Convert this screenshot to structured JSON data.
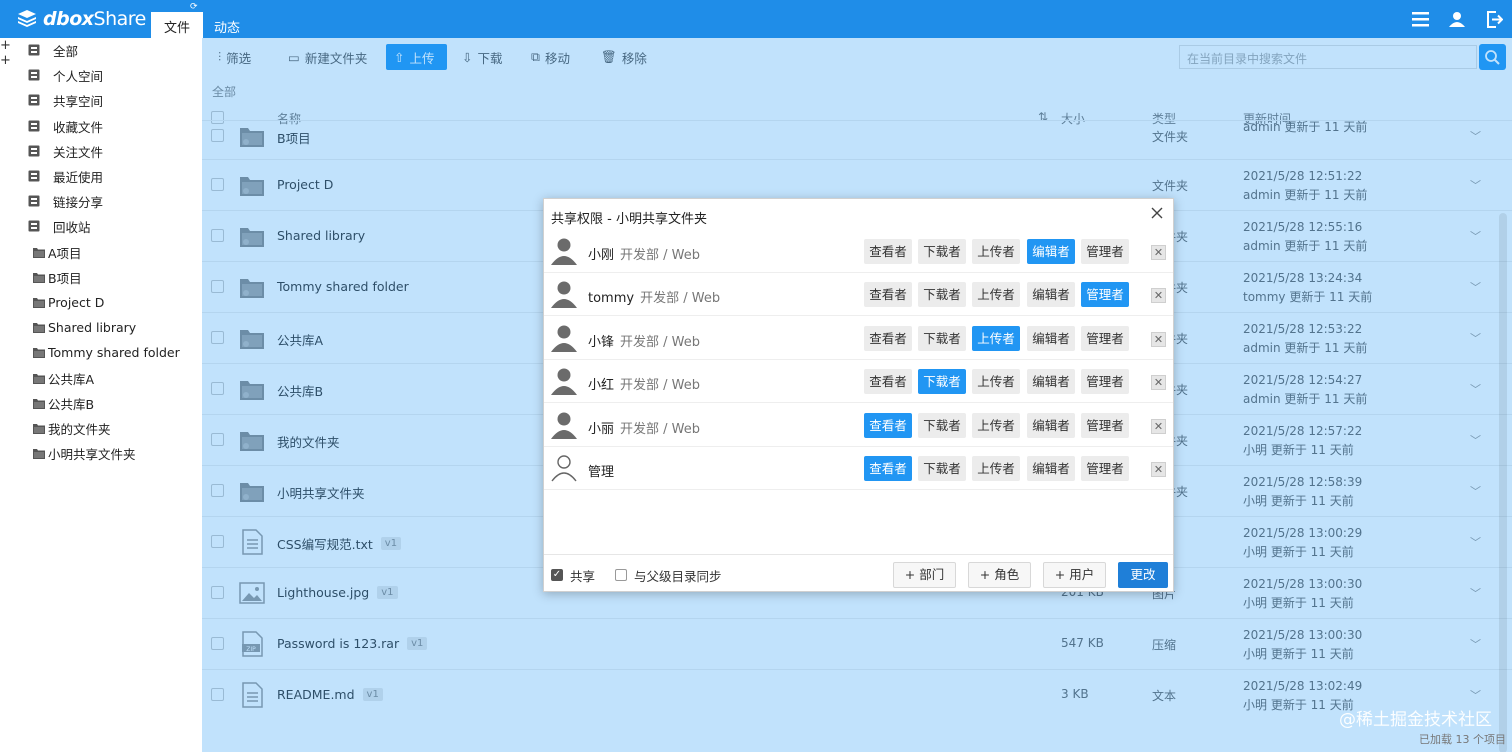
{
  "app": {
    "logo_text": "dbox",
    "logo_text2": "Share",
    "tabs": [
      {
        "label": "文件"
      },
      {
        "label": "动态"
      }
    ]
  },
  "sidebar": {
    "items": [
      {
        "label": "全部",
        "icon": "list-icon"
      },
      {
        "label": "个人空间",
        "icon": "person-icon"
      },
      {
        "label": "共享空间",
        "icon": "share-space-icon"
      },
      {
        "label": "收藏文件",
        "icon": "star-icon"
      },
      {
        "label": "关注文件",
        "icon": "heart-icon"
      },
      {
        "label": "最近使用",
        "icon": "clock-icon"
      },
      {
        "label": "链接分享",
        "icon": "share-icon"
      },
      {
        "label": "回收站",
        "icon": "trash-icon"
      },
      {
        "label": "A项目",
        "icon": "folder-icon"
      },
      {
        "label": "B项目",
        "icon": "folder-icon"
      },
      {
        "label": "Project D",
        "icon": "folder-icon"
      },
      {
        "label": "Shared library",
        "icon": "folder-icon"
      },
      {
        "label": "Tommy shared folder",
        "icon": "folder-icon"
      },
      {
        "label": "公共库A",
        "icon": "folder-icon"
      },
      {
        "label": "公共库B",
        "icon": "folder-icon"
      },
      {
        "label": "我的文件夹",
        "icon": "folder-icon"
      },
      {
        "label": "小明共享文件夹",
        "icon": "folder-icon"
      }
    ]
  },
  "toolbar": {
    "filter": "筛选",
    "new_folder": "新建文件夹",
    "upload": "上传",
    "download": "下载",
    "move": "移动",
    "remove": "移除",
    "search_placeholder": "在当前目录中搜索文件"
  },
  "breadcrumb": "全部",
  "table": {
    "headers": {
      "name": "名称",
      "size": "大小",
      "type": "类型",
      "time": "更新时间"
    },
    "rows": [
      {
        "name": "B项目",
        "ver": "",
        "size": "",
        "type": "文件夹",
        "time": "",
        "by": "admin 更新于 11 天前",
        "icon": "folder"
      },
      {
        "name": "Project D",
        "ver": "",
        "size": "",
        "type": "文件夹",
        "time": "2021/5/28 12:51:22",
        "by": "admin 更新于 11 天前",
        "icon": "folder"
      },
      {
        "name": "Shared library",
        "ver": "",
        "size": "",
        "type": "文件夹",
        "time": "2021/5/28 12:55:16",
        "by": "admin 更新于 11 天前",
        "icon": "folder"
      },
      {
        "name": "Tommy shared folder",
        "ver": "",
        "size": "",
        "type": "文件夹",
        "time": "2021/5/28 13:24:34",
        "by": "tommy 更新于 11 天前",
        "icon": "folder"
      },
      {
        "name": "公共库A",
        "ver": "",
        "size": "",
        "type": "文件夹",
        "time": "2021/5/28 12:53:22",
        "by": "admin 更新于 11 天前",
        "icon": "folder"
      },
      {
        "name": "公共库B",
        "ver": "",
        "size": "",
        "type": "文件夹",
        "time": "2021/5/28 12:54:27",
        "by": "admin 更新于 11 天前",
        "icon": "folder"
      },
      {
        "name": "我的文件夹",
        "ver": "",
        "size": "",
        "type": "文件夹",
        "time": "2021/5/28 12:57:22",
        "by": "小明 更新于 11 天前",
        "icon": "folder"
      },
      {
        "name": "小明共享文件夹",
        "ver": "",
        "size": "",
        "type": "文件夹",
        "time": "2021/5/28 12:58:39",
        "by": "小明 更新于 11 天前",
        "icon": "folder"
      },
      {
        "name": "CSS编写规范.txt",
        "ver": "v1",
        "size": "",
        "type": "",
        "time": "2021/5/28 13:00:29",
        "by": "小明 更新于 11 天前",
        "icon": "doc"
      },
      {
        "name": "Lighthouse.jpg",
        "ver": "v1",
        "size": "201 KB",
        "type": "图片",
        "time": "2021/5/28 13:00:30",
        "by": "小明 更新于 11 天前",
        "icon": "image"
      },
      {
        "name": "Password is 123.rar",
        "ver": "v1",
        "size": "547 KB",
        "type": "压缩",
        "time": "2021/5/28 13:00:30",
        "by": "小明 更新于 11 天前",
        "icon": "zip"
      },
      {
        "name": "README.md",
        "ver": "v1",
        "size": "3 KB",
        "type": "文本",
        "time": "2021/5/28 13:02:49",
        "by": "小明 更新于 11 天前",
        "icon": "doc"
      }
    ]
  },
  "status": "已加载 13 个项目",
  "dialog": {
    "title": "共享权限 - 小明共享文件夹",
    "roles": [
      "查看者",
      "下载者",
      "上传者",
      "编辑者",
      "管理者"
    ],
    "users": [
      {
        "name": "小刚",
        "dept": "开发部 / Web",
        "active": 3,
        "avatar": "user-filled"
      },
      {
        "name": "tommy",
        "dept": "开发部 / Web",
        "active": 4,
        "avatar": "user-filled"
      },
      {
        "name": "小锋",
        "dept": "开发部 / Web",
        "active": 2,
        "avatar": "user-filled"
      },
      {
        "name": "小红",
        "dept": "开发部 / Web",
        "active": 1,
        "avatar": "user-filled"
      },
      {
        "name": "小丽",
        "dept": "开发部 / Web",
        "active": 0,
        "avatar": "user-filled"
      },
      {
        "name": "管理",
        "dept": "",
        "active": 0,
        "avatar": "user-outline"
      }
    ],
    "share_label": "共享",
    "sync_label": "与父级目录同步",
    "add_dept": "+ 部门",
    "add_role": "+ 角色",
    "add_user": "+ 用户",
    "submit": "更改"
  },
  "watermark": "@稀土掘金技术社区",
  "colors": {
    "primary": "#1f8de8",
    "button": "#2196f3"
  }
}
